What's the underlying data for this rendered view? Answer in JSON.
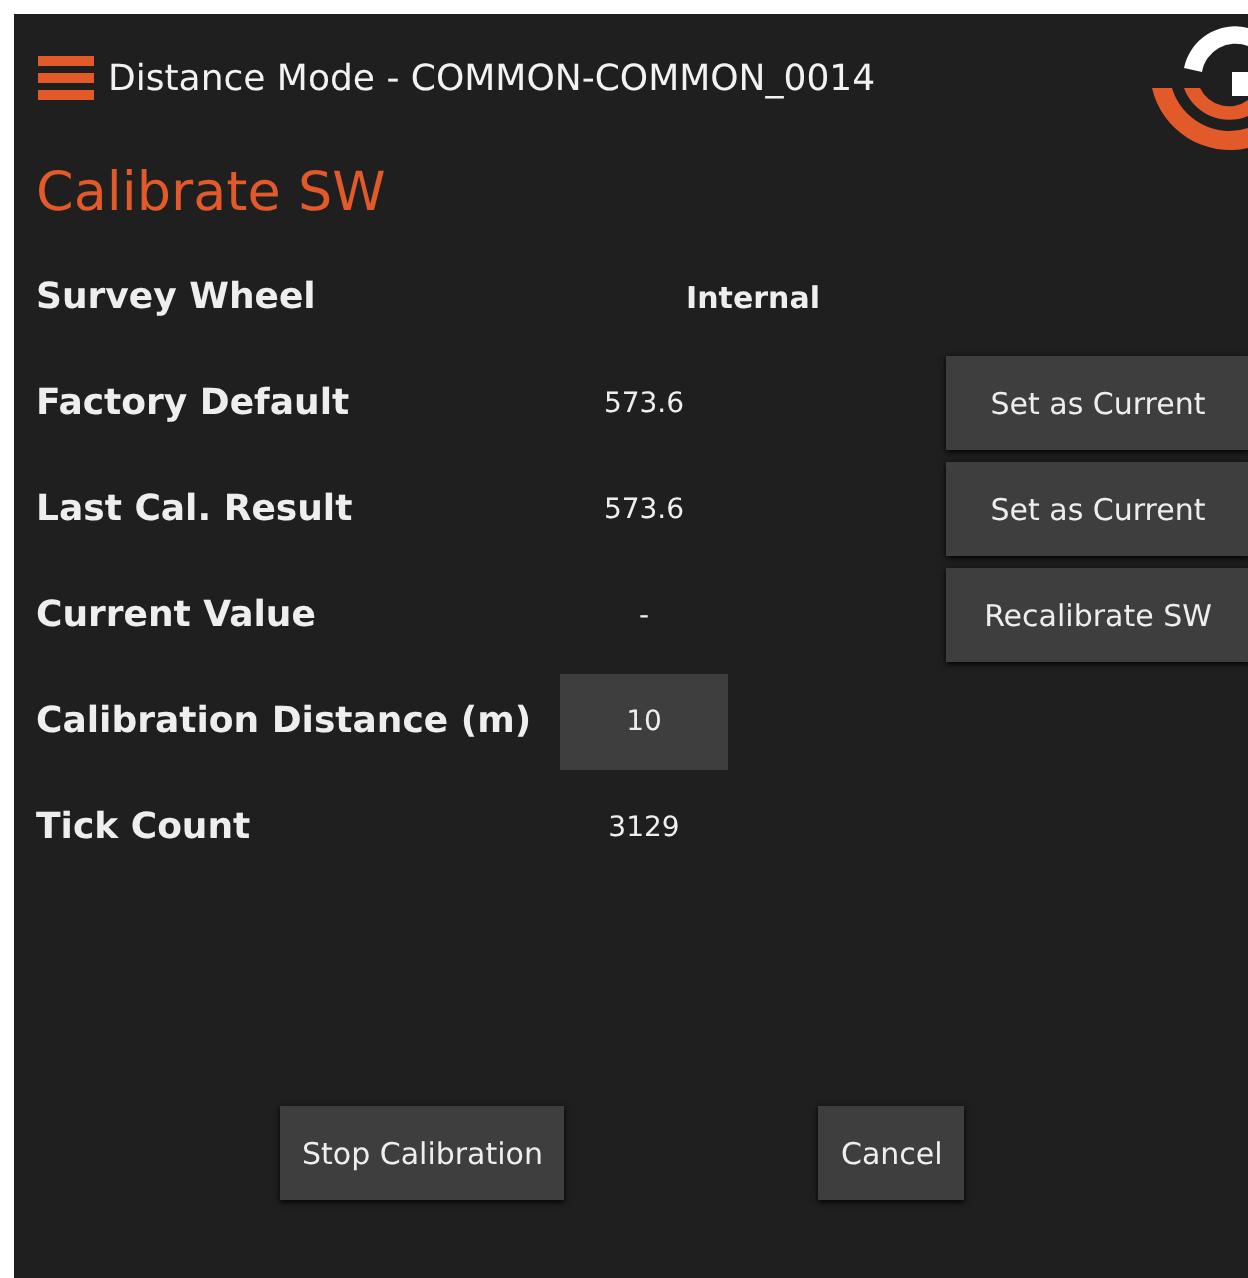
{
  "header": {
    "title": "Distance Mode - COMMON-COMMON_0014"
  },
  "page_title": "Calibrate SW",
  "rows": [
    {
      "kind": "info",
      "label": "Survey Wheel",
      "value": "Internal"
    },
    {
      "kind": "value",
      "label": "Factory Default",
      "value": "573.6",
      "button": "Set as Current"
    },
    {
      "kind": "value",
      "label": "Last Cal. Result",
      "value": "573.6",
      "button": "Set as Current"
    },
    {
      "kind": "value",
      "label": "Current Value",
      "value": "-",
      "button": "Recalibrate SW"
    },
    {
      "kind": "field",
      "label": "Calibration Distance (m)",
      "value": "10"
    },
    {
      "kind": "value",
      "label": "Tick Count",
      "value": "3129"
    }
  ],
  "buttons": [
    "Stop Calibration",
    "Cancel"
  ]
}
